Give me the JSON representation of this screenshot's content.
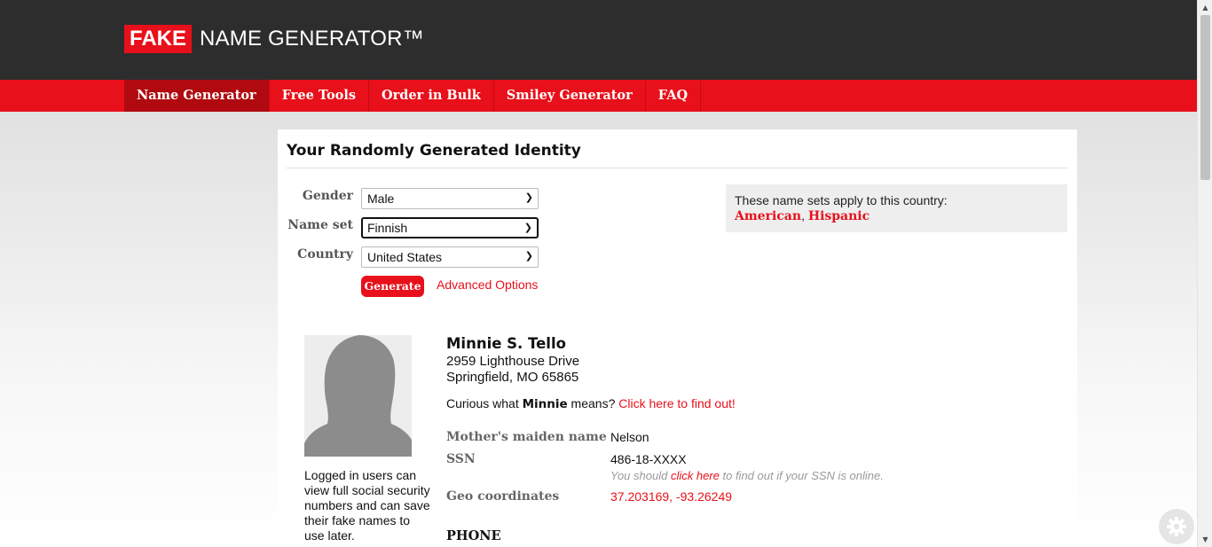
{
  "header": {
    "logo_fake": "FAKE",
    "logo_rest": "NAME GENERATOR™"
  },
  "nav": {
    "items": [
      {
        "label": "Name Generator",
        "active": true
      },
      {
        "label": "Free Tools"
      },
      {
        "label": "Order in Bulk"
      },
      {
        "label": "Smiley Generator"
      },
      {
        "label": "FAQ"
      }
    ]
  },
  "main": {
    "title": "Your Randomly Generated Identity",
    "form": {
      "gender_label": "Gender",
      "gender_value": "Male",
      "nameset_label": "Name set",
      "nameset_value": "Finnish",
      "country_label": "Country",
      "country_value": "United States",
      "generate_label": "Generate",
      "advanced_label": "Advanced Options"
    },
    "note": {
      "text": "These name sets apply to this country:",
      "set1": "American",
      "sep": ", ",
      "set2": "Hispanic"
    },
    "identity": {
      "name": "Minnie S. Tello",
      "address_line1": "2959 Lighthouse Drive",
      "address_line2": "Springfield, MO 65865",
      "curious_prefix": "Curious what ",
      "curious_name": "Minnie",
      "curious_suffix": " means? ",
      "curious_link": "Click here to find out!",
      "avatar_caption": "Logged in users can view full social security numbers and can save their fake names to use later.",
      "maiden_label": "Mother's maiden name",
      "maiden_value": "Nelson",
      "ssn_label": "SSN",
      "ssn_value": "486-18-XXXX",
      "ssn_hint_prefix": "You should ",
      "ssn_hint_link": "click here",
      "ssn_hint_suffix": " to find out if your SSN is online.",
      "geo_label": "Geo coordinates",
      "geo_value": "37.203169, -93.26249",
      "phone_heading": "PHONE"
    }
  },
  "colors": {
    "brand_red": "#e8101a",
    "header_dark": "#2d2d2d"
  }
}
